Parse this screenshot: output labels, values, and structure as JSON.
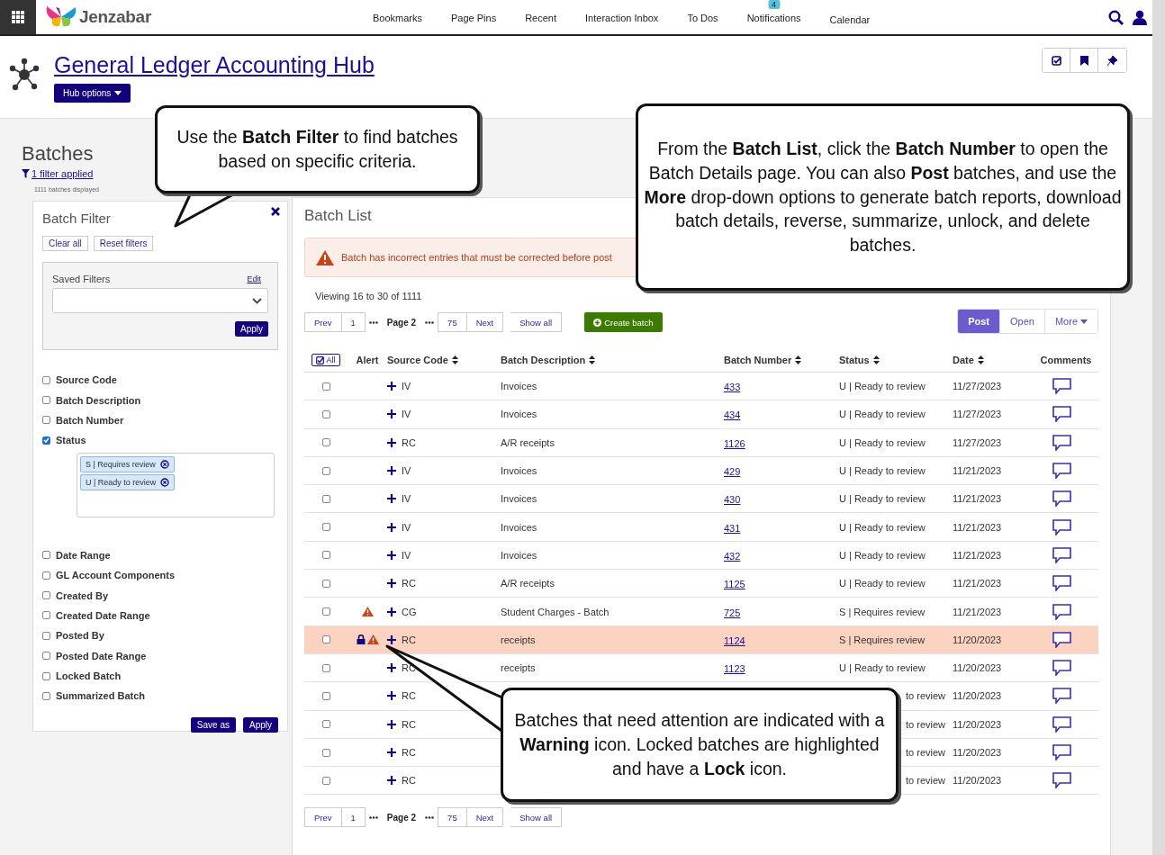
{
  "topbar": {
    "brand": "Jenzabar",
    "nav": [
      {
        "label": "Bookmarks"
      },
      {
        "label": "Page Pins"
      },
      {
        "label": "Recent"
      },
      {
        "label": "Interaction Inbox"
      },
      {
        "label": "To Dos"
      },
      {
        "label": "Notifications",
        "badge": "4"
      },
      {
        "label": "Calendar"
      }
    ]
  },
  "hub": {
    "title": "General Ledger Accounting Hub",
    "options_button": "Hub options"
  },
  "sidebar": {
    "title": "Batches",
    "filter_link": "1 filter applied",
    "count_note": "1111 batches displayed",
    "filter_panel": {
      "title": "Batch Filter",
      "buttons": [
        "Clear all",
        "Reset filters"
      ],
      "saved_filters": {
        "label": "Saved Filters",
        "edit": "Edit",
        "apply": "Apply"
      },
      "filters": [
        {
          "label": "Source Code",
          "checked": false
        },
        {
          "label": "Batch Description",
          "checked": false
        },
        {
          "label": "Batch Number",
          "checked": false
        },
        {
          "label": "Status",
          "checked": true,
          "chips": [
            "S | Requires review",
            "U | Ready to review"
          ]
        },
        {
          "label": "Date Range",
          "checked": false
        },
        {
          "label": "GL Account Components",
          "checked": false
        },
        {
          "label": "Created By",
          "checked": false
        },
        {
          "label": "Created Date Range",
          "checked": false
        },
        {
          "label": "Posted By",
          "checked": false
        },
        {
          "label": "Posted Date Range",
          "checked": false
        },
        {
          "label": "Locked Batch",
          "checked": false
        },
        {
          "label": "Summarized Batch",
          "checked": false
        }
      ],
      "footer_buttons": [
        "Save as",
        "Apply"
      ]
    }
  },
  "batch_list": {
    "title": "Batch List",
    "alert": "Batch has incorrect entries that must be corrected before post",
    "viewing": "Viewing 16 to 30 of 1111",
    "pager": {
      "prev": "Prev",
      "first": "1",
      "current": "Page 2",
      "last": "75",
      "next": "Next",
      "show_all": "Show all"
    },
    "create_button": "Create batch",
    "actions": [
      {
        "label": "Post",
        "selected": true
      },
      {
        "label": "Open",
        "selected": false
      },
      {
        "label": "More",
        "selected": false
      }
    ],
    "select_all": "All",
    "columns": [
      {
        "label": "Alert",
        "sortable": false
      },
      {
        "label": "Source Code",
        "sortable": true
      },
      {
        "label": "Batch Description",
        "sortable": true
      },
      {
        "label": "Batch Number",
        "sortable": true
      },
      {
        "label": "Status",
        "sortable": true
      },
      {
        "label": "Date",
        "sortable": true
      },
      {
        "label": "Comments",
        "sortable": false
      }
    ],
    "rows": [
      {
        "checked": false,
        "warning": false,
        "locked": false,
        "source": "IV",
        "description": "Invoices",
        "number": "433",
        "status": "U | Ready to review",
        "date": "11/27/2023"
      },
      {
        "checked": false,
        "warning": false,
        "locked": false,
        "source": "IV",
        "description": "Invoices",
        "number": "434",
        "status": "U | Ready to review",
        "date": "11/27/2023"
      },
      {
        "checked": false,
        "warning": false,
        "locked": false,
        "source": "RC",
        "description": "A/R receipts",
        "number": "1126",
        "status": "U | Ready to review",
        "date": "11/27/2023"
      },
      {
        "checked": false,
        "warning": false,
        "locked": false,
        "source": "IV",
        "description": "Invoices",
        "number": "429",
        "status": "U | Ready to review",
        "date": "11/21/2023"
      },
      {
        "checked": false,
        "warning": false,
        "locked": false,
        "source": "IV",
        "description": "Invoices",
        "number": "430",
        "status": "U | Ready to review",
        "date": "11/21/2023"
      },
      {
        "checked": false,
        "warning": false,
        "locked": false,
        "source": "IV",
        "description": "Invoices",
        "number": "431",
        "status": "U | Ready to review",
        "date": "11/21/2023"
      },
      {
        "checked": false,
        "warning": false,
        "locked": false,
        "source": "IV",
        "description": "Invoices",
        "number": "432",
        "status": "U | Ready to review",
        "date": "11/21/2023"
      },
      {
        "checked": false,
        "warning": false,
        "locked": false,
        "source": "RC",
        "description": "A/R receipts",
        "number": "1125",
        "status": "U | Ready to review",
        "date": "11/21/2023"
      },
      {
        "checked": false,
        "warning": true,
        "locked": false,
        "source": "CG",
        "description": "Student Charges - Batch",
        "number": "725",
        "status": "S | Requires review",
        "date": "11/21/2023"
      },
      {
        "checked": false,
        "warning": true,
        "locked": true,
        "source": "RC",
        "description": "receipts",
        "number": "1124",
        "status": "S | Requires review",
        "date": "11/20/2023"
      },
      {
        "checked": false,
        "warning": false,
        "locked": false,
        "source": "RC",
        "description": "receipts",
        "number": "1123",
        "status": "U | Ready to review",
        "date": "11/20/2023"
      },
      {
        "checked": false,
        "warning": false,
        "locked": false,
        "source": "RC",
        "status": "to review",
        "date": "11/20/2023"
      },
      {
        "checked": false,
        "warning": false,
        "locked": false,
        "source": "RC",
        "status": "to review",
        "date": "11/20/2023"
      },
      {
        "checked": false,
        "warning": false,
        "locked": false,
        "source": "RC",
        "status": "to review",
        "date": "11/20/2023"
      },
      {
        "checked": false,
        "warning": false,
        "locked": false,
        "source": "RC",
        "status": "to review",
        "date": "11/20/2023"
      }
    ],
    "bottom_pager": {
      "prev": "Prev",
      "first": "1",
      "current": "Page 2",
      "last": "75",
      "next": "Next",
      "show_all": "Show all"
    }
  },
  "callouts": [
    {
      "text": "Use the **Batch Filter** to find batches based on specific criteria."
    },
    {
      "text": "From the **Batch List**, click the **Batch Number** to open the Batch Details page. You can also **Post** batches, and use the **More** drop-down options to generate batch reports, download batch details, reverse, summarize, unlock, and delete batches."
    },
    {
      "text": "Batches that need attention are indicated with a **Warning** icon. Locked batches are highlighted and have a **Lock** icon."
    }
  ]
}
